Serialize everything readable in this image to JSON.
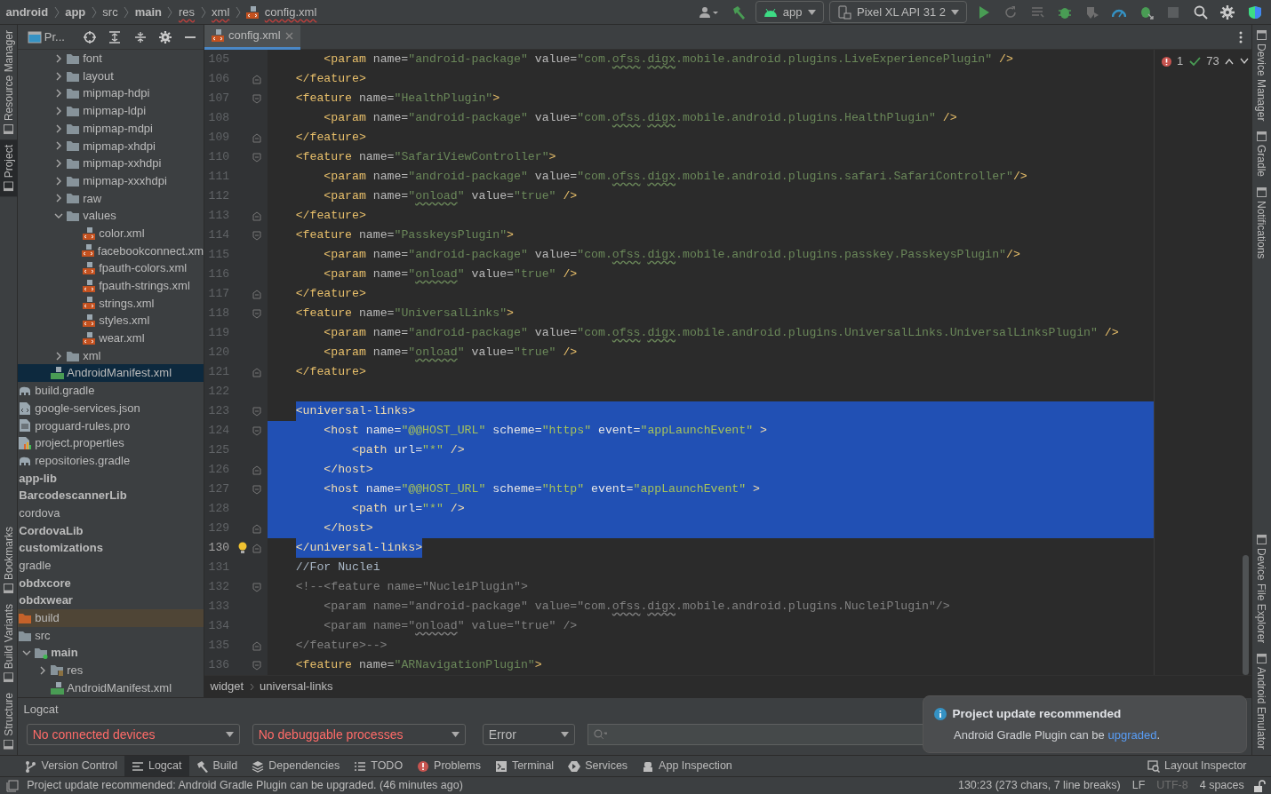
{
  "breadcrumb": [
    {
      "label": "android",
      "kind": "module",
      "error": false
    },
    {
      "label": "app",
      "kind": "module",
      "error": false
    },
    {
      "label": "src",
      "kind": "directory",
      "error": false
    },
    {
      "label": "main",
      "kind": "source-root",
      "error": false
    },
    {
      "label": "res",
      "kind": "directory",
      "error": true
    },
    {
      "label": "xml",
      "kind": "directory",
      "error": true
    },
    {
      "label": "config.xml",
      "kind": "file",
      "error": true
    }
  ],
  "toolbar": {
    "configuration": "app",
    "device": "Pixel XL API 31 2"
  },
  "left_strip": {
    "top": [
      {
        "label": "Resource Manager",
        "selected": false
      },
      {
        "label": "Project",
        "selected": true
      }
    ],
    "bottom": [
      {
        "label": "Bookmarks",
        "selected": false
      },
      {
        "label": "Build Variants",
        "selected": false
      },
      {
        "label": "Structure",
        "selected": false
      }
    ]
  },
  "right_strip": {
    "top": [
      {
        "label": "Device Manager"
      },
      {
        "label": "Gradle"
      },
      {
        "label": "Notifications"
      }
    ],
    "bottom": [
      {
        "label": "Device File Explorer"
      },
      {
        "label": "Android Emulator"
      }
    ]
  },
  "project_panel": {
    "title": "Pr...",
    "tree": [
      {
        "children": [
          {
            "children": [
              {
                "children": [
                  {
                    "children": [
                      {
                        "label": "font",
                        "kind": "folder",
                        "expanded": false,
                        "selected": false
                      },
                      {
                        "label": "layout",
                        "kind": "folder",
                        "expanded": false,
                        "selected": false
                      },
                      {
                        "label": "mipmap-hdpi",
                        "kind": "folder",
                        "expanded": false,
                        "selected": false
                      },
                      {
                        "label": "mipmap-ldpi",
                        "kind": "folder",
                        "expanded": false,
                        "selected": false
                      },
                      {
                        "label": "mipmap-mdpi",
                        "kind": "folder",
                        "expanded": false,
                        "selected": false
                      },
                      {
                        "label": "mipmap-xhdpi",
                        "kind": "folder",
                        "expanded": false,
                        "selected": false
                      },
                      {
                        "label": "mipmap-xxhdpi",
                        "kind": "folder",
                        "expanded": false,
                        "selected": false
                      },
                      {
                        "label": "mipmap-xxxhdpi",
                        "kind": "folder",
                        "expanded": false,
                        "selected": false
                      },
                      {
                        "label": "raw",
                        "kind": "folder",
                        "expanded": false,
                        "selected": false
                      },
                      {
                        "label": "values",
                        "kind": "folder",
                        "expanded": true,
                        "selected": false,
                        "children": [
                          {
                            "label": "color.xml",
                            "kind": "xml",
                            "selected": false
                          },
                          {
                            "label": "facebookconnect.xm",
                            "kind": "xml",
                            "selected": false
                          },
                          {
                            "label": "fpauth-colors.xml",
                            "kind": "xml",
                            "selected": false
                          },
                          {
                            "label": "fpauth-strings.xml",
                            "kind": "xml",
                            "selected": false
                          },
                          {
                            "label": "strings.xml",
                            "kind": "xml",
                            "selected": false
                          },
                          {
                            "label": "styles.xml",
                            "kind": "xml",
                            "selected": false
                          },
                          {
                            "label": "wear.xml",
                            "kind": "xml",
                            "selected": false
                          }
                        ]
                      },
                      {
                        "label": "xml",
                        "kind": "folder",
                        "expanded": false,
                        "selected": false
                      }
                    ]
                  },
                  {
                    "label": "AndroidManifest.xml",
                    "kind": "manifest",
                    "selected": true
                  }
                ]
              }
            ]
          },
          {
            "label": "build.gradle",
            "kind": "gradle",
            "selected": false
          },
          {
            "label": "google-services.json",
            "kind": "json",
            "selected": false
          },
          {
            "label": "proguard-rules.pro",
            "kind": "text",
            "selected": false
          },
          {
            "label": "project.properties",
            "kind": "properties",
            "selected": false
          },
          {
            "label": "repositories.gradle",
            "kind": "gradle",
            "selected": false
          }
        ]
      },
      {
        "label": "app-lib",
        "kind": "module",
        "selected": false
      },
      {
        "label": "BarcodescannerLib",
        "kind": "module",
        "selected": false
      },
      {
        "label": "cordova",
        "kind": "folder",
        "selected": false
      },
      {
        "label": "CordovaLib",
        "kind": "module",
        "selected": false
      },
      {
        "label": "customizations",
        "kind": "module",
        "selected": false
      },
      {
        "label": "gradle",
        "kind": "folder",
        "selected": false
      },
      {
        "label": "obdxcore",
        "kind": "module",
        "selected": false
      },
      {
        "label": "obdxwear",
        "kind": "module",
        "selected": false,
        "children": [
          {
            "label": "build",
            "kind": "excluded",
            "selected": false
          },
          {
            "label": "src",
            "kind": "folder",
            "selected": false,
            "children": [
              {
                "label": "main",
                "kind": "source-root",
                "expanded": true,
                "selected": false,
                "children": [
                  {
                    "label": "res",
                    "kind": "resources",
                    "expanded": false,
                    "selected": false
                  },
                  {
                    "label": "AndroidManifest.xml",
                    "kind": "manifest",
                    "selected": false
                  }
                ]
              }
            ]
          }
        ]
      }
    ]
  },
  "editor": {
    "tabs": [
      {
        "label": "config.xml",
        "selected": true
      }
    ],
    "inspections": {
      "errors": "1",
      "checks": "73"
    },
    "lines": [
      {
        "number": "105",
        "kind": "plain",
        "selected": false,
        "current": false,
        "segments": [
          {
            "kind": "tag",
            "text": "        <param "
          },
          {
            "kind": "attr",
            "text": "name="
          },
          {
            "kind": "value",
            "text": "\"android-package\""
          },
          {
            "kind": "attr",
            "text": " value="
          },
          {
            "kind": "value",
            "text": "\"com."
          },
          {
            "kind": "typo",
            "text": "ofss"
          },
          {
            "kind": "value",
            "text": "."
          },
          {
            "kind": "typo",
            "text": "digx"
          },
          {
            "kind": "value",
            "text": ".mobile.android.plugins.LiveExperiencePlugin\""
          },
          {
            "kind": "tag",
            "text": " />"
          }
        ]
      },
      {
        "number": "106",
        "kind": "fold-end",
        "selected": false,
        "current": false,
        "segments": [
          {
            "kind": "tag",
            "text": "    </feature>"
          }
        ]
      },
      {
        "number": "107",
        "kind": "fold-start",
        "selected": false,
        "current": false,
        "segments": [
          {
            "kind": "tag",
            "text": "    <feature "
          },
          {
            "kind": "attr",
            "text": "name="
          },
          {
            "kind": "value",
            "text": "\"HealthPlugin\""
          },
          {
            "kind": "tag",
            "text": ">"
          }
        ]
      },
      {
        "number": "108",
        "kind": "plain",
        "selected": false,
        "current": false,
        "segments": [
          {
            "kind": "tag",
            "text": "        <param "
          },
          {
            "kind": "attr",
            "text": "name="
          },
          {
            "kind": "value",
            "text": "\"android-package\""
          },
          {
            "kind": "attr",
            "text": " value="
          },
          {
            "kind": "value",
            "text": "\"com."
          },
          {
            "kind": "typo",
            "text": "ofss"
          },
          {
            "kind": "value",
            "text": "."
          },
          {
            "kind": "typo",
            "text": "digx"
          },
          {
            "kind": "value",
            "text": ".mobile.android.plugins.HealthPlugin\""
          },
          {
            "kind": "tag",
            "text": " />"
          }
        ]
      },
      {
        "number": "109",
        "kind": "fold-end",
        "selected": false,
        "current": false,
        "segments": [
          {
            "kind": "tag",
            "text": "    </feature>"
          }
        ]
      },
      {
        "number": "110",
        "kind": "fold-start",
        "selected": false,
        "current": false,
        "segments": [
          {
            "kind": "tag",
            "text": "    <feature "
          },
          {
            "kind": "attr",
            "text": "name="
          },
          {
            "kind": "value",
            "text": "\"SafariViewController\""
          },
          {
            "kind": "tag",
            "text": ">"
          }
        ]
      },
      {
        "number": "111",
        "kind": "plain",
        "selected": false,
        "current": false,
        "segments": [
          {
            "kind": "tag",
            "text": "        <param "
          },
          {
            "kind": "attr",
            "text": "name="
          },
          {
            "kind": "value",
            "text": "\"android-package\""
          },
          {
            "kind": "attr",
            "text": " value="
          },
          {
            "kind": "value",
            "text": "\"com."
          },
          {
            "kind": "typo",
            "text": "ofss"
          },
          {
            "kind": "value",
            "text": "."
          },
          {
            "kind": "typo",
            "text": "digx"
          },
          {
            "kind": "value",
            "text": ".mobile.android.plugins.safari.SafariController\""
          },
          {
            "kind": "tag",
            "text": "/>"
          }
        ]
      },
      {
        "number": "112",
        "kind": "plain",
        "selected": false,
        "current": false,
        "segments": [
          {
            "kind": "tag",
            "text": "        <param "
          },
          {
            "kind": "attr",
            "text": "name="
          },
          {
            "kind": "value",
            "text": "\""
          },
          {
            "kind": "typo",
            "text": "onload"
          },
          {
            "kind": "value",
            "text": "\""
          },
          {
            "kind": "attr",
            "text": " value="
          },
          {
            "kind": "value",
            "text": "\"true\""
          },
          {
            "kind": "tag",
            "text": " />"
          }
        ]
      },
      {
        "number": "113",
        "kind": "fold-end",
        "selected": false,
        "current": false,
        "segments": [
          {
            "kind": "tag",
            "text": "    </feature>"
          }
        ]
      },
      {
        "number": "114",
        "kind": "fold-start",
        "selected": false,
        "current": false,
        "segments": [
          {
            "kind": "tag",
            "text": "    <feature "
          },
          {
            "kind": "attr",
            "text": "name="
          },
          {
            "kind": "value",
            "text": "\"PasskeysPlugin\""
          },
          {
            "kind": "tag",
            "text": ">"
          }
        ]
      },
      {
        "number": "115",
        "kind": "plain",
        "selected": false,
        "current": false,
        "segments": [
          {
            "kind": "tag",
            "text": "        <param "
          },
          {
            "kind": "attr",
            "text": "name="
          },
          {
            "kind": "value",
            "text": "\"android-package\""
          },
          {
            "kind": "attr",
            "text": " value="
          },
          {
            "kind": "value",
            "text": "\"com."
          },
          {
            "kind": "typo",
            "text": "ofss"
          },
          {
            "kind": "value",
            "text": "."
          },
          {
            "kind": "typo",
            "text": "digx"
          },
          {
            "kind": "value",
            "text": ".mobile.android.plugins.passkey.PasskeysPlugin\""
          },
          {
            "kind": "tag",
            "text": "/>"
          }
        ]
      },
      {
        "number": "116",
        "kind": "plain",
        "selected": false,
        "current": false,
        "segments": [
          {
            "kind": "tag",
            "text": "        <param "
          },
          {
            "kind": "attr",
            "text": "name="
          },
          {
            "kind": "value",
            "text": "\""
          },
          {
            "kind": "typo",
            "text": "onload"
          },
          {
            "kind": "value",
            "text": "\""
          },
          {
            "kind": "attr",
            "text": " value="
          },
          {
            "kind": "value",
            "text": "\"true\""
          },
          {
            "kind": "tag",
            "text": " />"
          }
        ]
      },
      {
        "number": "117",
        "kind": "fold-end",
        "selected": false,
        "current": false,
        "segments": [
          {
            "kind": "tag",
            "text": "    </feature>"
          }
        ]
      },
      {
        "number": "118",
        "kind": "fold-start",
        "selected": false,
        "current": false,
        "segments": [
          {
            "kind": "tag",
            "text": "    <feature "
          },
          {
            "kind": "attr",
            "text": "name="
          },
          {
            "kind": "value",
            "text": "\"UniversalLinks\""
          },
          {
            "kind": "tag",
            "text": ">"
          }
        ]
      },
      {
        "number": "119",
        "kind": "plain",
        "selected": false,
        "current": false,
        "segments": [
          {
            "kind": "tag",
            "text": "        <param "
          },
          {
            "kind": "attr",
            "text": "name="
          },
          {
            "kind": "value",
            "text": "\"android-package\""
          },
          {
            "kind": "attr",
            "text": " value="
          },
          {
            "kind": "value",
            "text": "\"com."
          },
          {
            "kind": "typo",
            "text": "ofss"
          },
          {
            "kind": "value",
            "text": "."
          },
          {
            "kind": "typo",
            "text": "digx"
          },
          {
            "kind": "value",
            "text": ".mobile.android.plugins.UniversalLinks.UniversalLinksPlugin\""
          },
          {
            "kind": "tag",
            "text": " />"
          }
        ]
      },
      {
        "number": "120",
        "kind": "plain",
        "selected": false,
        "current": false,
        "segments": [
          {
            "kind": "tag",
            "text": "        <param "
          },
          {
            "kind": "attr",
            "text": "name="
          },
          {
            "kind": "value",
            "text": "\""
          },
          {
            "kind": "typo",
            "text": "onload"
          },
          {
            "kind": "value",
            "text": "\""
          },
          {
            "kind": "attr",
            "text": " value="
          },
          {
            "kind": "value",
            "text": "\"true\""
          },
          {
            "kind": "tag",
            "text": " />"
          }
        ]
      },
      {
        "number": "121",
        "kind": "fold-end",
        "selected": false,
        "current": false,
        "segments": [
          {
            "kind": "tag",
            "text": "    </feature>"
          }
        ]
      },
      {
        "number": "122",
        "kind": "plain",
        "selected": false,
        "current": false
      },
      {
        "number": "123",
        "kind": "fold-start",
        "selected": true,
        "current": false,
        "segments": [
          {
            "kind": "tag",
            "text": "    <universal-links>"
          }
        ]
      },
      {
        "number": "124",
        "kind": "fold-start",
        "selected": true,
        "current": false,
        "segments": [
          {
            "kind": "tag",
            "text": "        <host "
          },
          {
            "kind": "attr",
            "text": "name="
          },
          {
            "kind": "value",
            "text": "\"@@HOST_URL\""
          },
          {
            "kind": "attr",
            "text": " scheme="
          },
          {
            "kind": "value",
            "text": "\"https\""
          },
          {
            "kind": "attr",
            "text": " event="
          },
          {
            "kind": "value",
            "text": "\"appLaunchEvent\""
          },
          {
            "kind": "tag",
            "text": " >"
          }
        ]
      },
      {
        "number": "125",
        "kind": "plain",
        "selected": true,
        "current": false,
        "segments": [
          {
            "kind": "tag",
            "text": "            <path "
          },
          {
            "kind": "attr",
            "text": "url="
          },
          {
            "kind": "value",
            "text": "\"*\""
          },
          {
            "kind": "tag",
            "text": " />"
          }
        ]
      },
      {
        "number": "126",
        "kind": "fold-end",
        "selected": true,
        "current": false,
        "segments": [
          {
            "kind": "tag",
            "text": "        </host>"
          }
        ]
      },
      {
        "number": "127",
        "kind": "fold-start",
        "selected": true,
        "current": false,
        "segments": [
          {
            "kind": "tag",
            "text": "        <host "
          },
          {
            "kind": "attr",
            "text": "name="
          },
          {
            "kind": "value",
            "text": "\"@@HOST_URL\""
          },
          {
            "kind": "attr",
            "text": " scheme="
          },
          {
            "kind": "value",
            "text": "\"http\""
          },
          {
            "kind": "attr",
            "text": " event="
          },
          {
            "kind": "value",
            "text": "\"appLaunchEvent\""
          },
          {
            "kind": "tag",
            "text": " >"
          }
        ]
      },
      {
        "number": "128",
        "kind": "plain",
        "selected": true,
        "current": false,
        "segments": [
          {
            "kind": "tag",
            "text": "            <path "
          },
          {
            "kind": "attr",
            "text": "url="
          },
          {
            "kind": "value",
            "text": "\"*\""
          },
          {
            "kind": "tag",
            "text": " />"
          }
        ]
      },
      {
        "number": "129",
        "kind": "fold-end",
        "selected": true,
        "current": false,
        "segments": [
          {
            "kind": "tag",
            "text": "        </host>"
          }
        ]
      },
      {
        "number": "130",
        "kind": "fold-end",
        "selected": true,
        "current": true,
        "segments": [
          {
            "kind": "tag",
            "text": "    </universal-links>"
          }
        ]
      },
      {
        "number": "131",
        "kind": "plain",
        "selected": false,
        "current": false,
        "segments": [
          {
            "kind": "text",
            "text": "    //For Nuclei"
          }
        ]
      },
      {
        "number": "132",
        "kind": "fold-start",
        "selected": false,
        "current": false,
        "segments": [
          {
            "kind": "comment",
            "text": "    <!--<feature name=\"NucleiPlugin\">"
          }
        ]
      },
      {
        "number": "133",
        "kind": "plain",
        "selected": false,
        "current": false,
        "segments": [
          {
            "kind": "comment",
            "text": "        <param name=\"android-package\" value=\"com."
          },
          {
            "kind": "comment-typo",
            "text": "ofss"
          },
          {
            "kind": "comment",
            "text": "."
          },
          {
            "kind": "comment-typo",
            "text": "digx"
          },
          {
            "kind": "comment",
            "text": ".mobile.android.plugins.NucleiPlugin\"/>"
          }
        ]
      },
      {
        "number": "134",
        "kind": "plain",
        "selected": false,
        "current": false,
        "segments": [
          {
            "kind": "comment",
            "text": "        <param name=\""
          },
          {
            "kind": "comment-typo",
            "text": "onload"
          },
          {
            "kind": "comment",
            "text": "\" value=\"true\" />"
          }
        ]
      },
      {
        "number": "135",
        "kind": "fold-end",
        "selected": false,
        "current": false,
        "segments": [
          {
            "kind": "comment",
            "text": "    </feature>-->"
          }
        ]
      },
      {
        "number": "136",
        "kind": "fold-start",
        "selected": false,
        "current": false,
        "segments": [
          {
            "kind": "tag",
            "text": "    <feature "
          },
          {
            "kind": "attr",
            "text": "name="
          },
          {
            "kind": "value",
            "text": "\"ARNavigationPlugin\""
          },
          {
            "kind": "tag",
            "text": ">"
          }
        ]
      }
    ],
    "path": [
      "widget",
      "universal-links"
    ]
  },
  "logcat": {
    "title": "Logcat",
    "filters": [
      {
        "label": "No connected devices",
        "error": true
      },
      {
        "label": "No debuggable processes",
        "error": true
      },
      {
        "label": "Error",
        "error": false
      }
    ]
  },
  "notification": {
    "title": "Project update recommended",
    "text": "Android Gradle Plugin can be ",
    "link": "upgraded",
    "after": "."
  },
  "tool_windows": [
    {
      "label": "Version Control",
      "selected": false
    },
    {
      "label": "Logcat",
      "selected": true
    },
    {
      "label": "Build",
      "selected": false
    },
    {
      "label": "Dependencies",
      "selected": false
    },
    {
      "label": "TODO",
      "selected": false
    },
    {
      "label": "Problems",
      "selected": false
    },
    {
      "label": "Terminal",
      "selected": false
    },
    {
      "label": "Services",
      "selected": false
    },
    {
      "label": "App Inspection",
      "selected": false
    }
  ],
  "tool_windows_right": [
    {
      "label": "Layout Inspector",
      "selected": false
    }
  ],
  "status_bar": {
    "message": "Project update recommended: Android Gradle Plugin can be upgraded. (46 minutes ago)",
    "items": [
      {
        "label": "130:23 (273 chars, 7 line breaks)",
        "disabled": false
      },
      {
        "label": "LF",
        "disabled": false
      },
      {
        "label": "UTF-8",
        "disabled": true
      },
      {
        "label": "4 spaces",
        "disabled": false
      }
    ]
  }
}
